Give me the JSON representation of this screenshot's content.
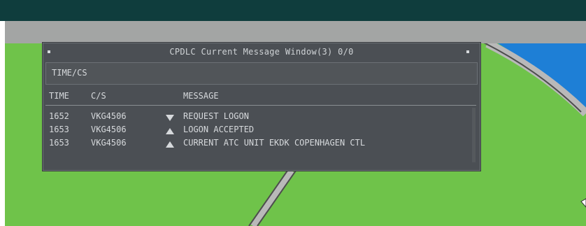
{
  "window": {
    "title": "CPDLC Current Message Window(3) 0/0",
    "filter_label": "TIME/CS"
  },
  "columns": {
    "time": "TIME",
    "callsign": "C/S",
    "message": "MESSAGE"
  },
  "messages": [
    {
      "time": "1652",
      "callsign": "VKG4506",
      "direction_icon": "triangle-down-icon",
      "text": "REQUEST LOGON"
    },
    {
      "time": "1653",
      "callsign": "VKG4506",
      "direction_icon": "triangle-up-icon",
      "text": "LOGON ACCEPTED"
    },
    {
      "time": "1653",
      "callsign": "VKG4506",
      "direction_icon": "triangle-up-icon",
      "text": "CURRENT ATC UNIT EKDK COPENHAGEN CTL"
    }
  ],
  "colors": {
    "top_strip": "#0f3d3d",
    "toolbar": "#a3a5a4",
    "map_land": "#6fc34a",
    "map_water": "#1e7fd6",
    "window_bg": "#4b4f54",
    "window_text": "#d6d9dc"
  }
}
